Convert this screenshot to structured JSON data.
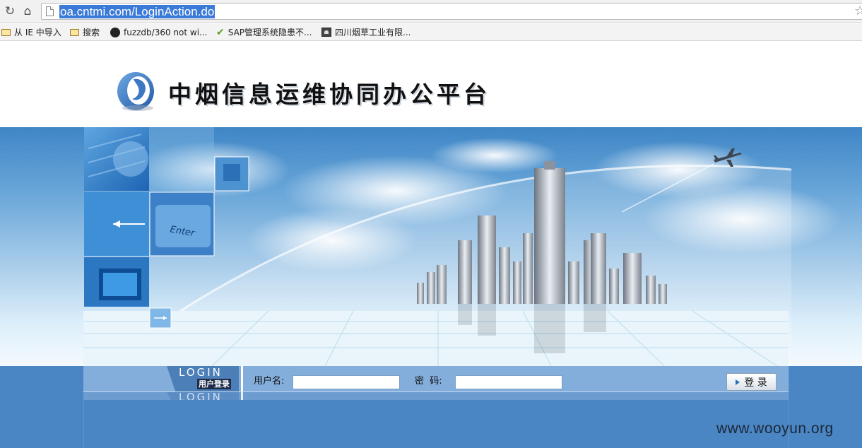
{
  "browser": {
    "url": "oa.cntmi.com/LoginAction.do",
    "bookmarks": [
      {
        "icon": "folder-icon",
        "label": "从 IE 中导入"
      },
      {
        "icon": "folder-icon",
        "label": "搜索"
      },
      {
        "icon": "github-icon",
        "label": "fuzzdb/360 not wi..."
      },
      {
        "icon": "check-icon",
        "label": "SAP管理系统隐患不..."
      },
      {
        "icon": "site-icon",
        "label": "四川烟草工业有限..."
      }
    ]
  },
  "header": {
    "title": "中烟信息运维协同办公平台"
  },
  "login": {
    "label_en": "LOGIN",
    "label_cn": "用户登录",
    "username_label": "用户名:",
    "username_value": "",
    "password_label": "密  码:",
    "password_value": "",
    "submit_label": "登 录"
  },
  "watermark": "www.wooyun.org",
  "colors": {
    "accent": "#4a85c4",
    "login_strip": "#83addb",
    "url_highlight": "#3a7ad8"
  }
}
